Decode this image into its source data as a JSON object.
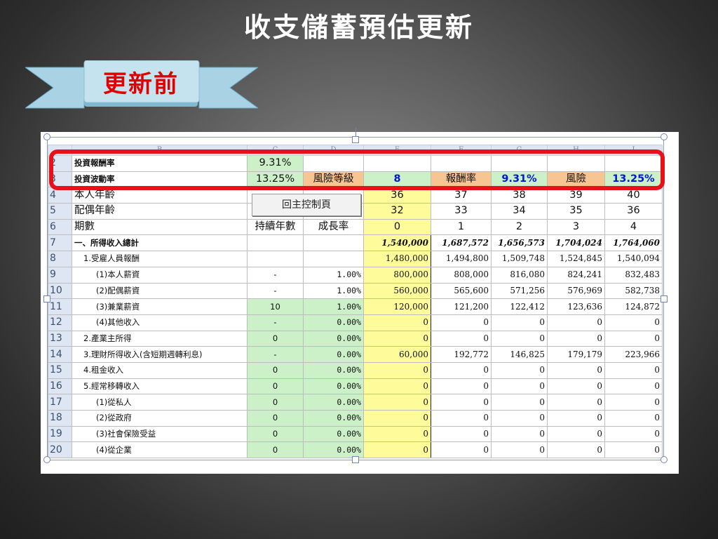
{
  "slide": {
    "title": "收支儲蓄預估更新",
    "ribbon_label": "更新前",
    "ribbon_color": "#a9d3e4",
    "label_color": "#e00000"
  },
  "spreadsheet": {
    "column_headers": [
      "B",
      "C",
      "D",
      "E",
      "F",
      "G",
      "H",
      "I"
    ],
    "control_button_label": "回主控制頁",
    "rows": [
      {
        "n": "2",
        "b": "投資報酬率",
        "c": "9.31%",
        "d": "",
        "e": "",
        "f": "",
        "g": "",
        "h": "",
        "i": ""
      },
      {
        "n": "3",
        "b": "投資波動率",
        "c": "13.25%",
        "d": "風險等級",
        "e": "8",
        "f": "報酬率",
        "g": "9.31%",
        "h": "風險",
        "i": "13.25%"
      },
      {
        "n": "4",
        "b": "本人年齡",
        "c": "",
        "d": "",
        "e": "36",
        "f": "37",
        "g": "38",
        "h": "39",
        "i": "40"
      },
      {
        "n": "5",
        "b": "配偶年齡",
        "c": "",
        "d": "",
        "e": "32",
        "f": "33",
        "g": "34",
        "h": "35",
        "i": "36"
      },
      {
        "n": "6",
        "b": "期數",
        "c": "持續年數",
        "d": "成長率",
        "e": "0",
        "f": "1",
        "g": "2",
        "h": "3",
        "i": "4"
      },
      {
        "n": "7",
        "b": "一、所得收入總計",
        "c": "",
        "d": "",
        "e": "1,540,000",
        "f": "1,687,572",
        "g": "1,656,573",
        "h": "1,704,024",
        "i": "1,764,060"
      },
      {
        "n": "8",
        "b": "1.受雇人員報酬",
        "c": "",
        "d": "",
        "e": "1,480,000",
        "f": "1,494,800",
        "g": "1,509,748",
        "h": "1,524,845",
        "i": "1,540,094"
      },
      {
        "n": "9",
        "b": "(1)本人薪資",
        "c": "-",
        "d": "1.00%",
        "e": "800,000",
        "f": "808,000",
        "g": "816,080",
        "h": "824,241",
        "i": "832,483"
      },
      {
        "n": "10",
        "b": "(2)配偶薪資",
        "c": "-",
        "d": "1.00%",
        "e": "560,000",
        "f": "565,600",
        "g": "571,256",
        "h": "576,969",
        "i": "582,738"
      },
      {
        "n": "11",
        "b": "(3)兼業薪資",
        "c": "10",
        "d": "1.00%",
        "e": "120,000",
        "f": "121,200",
        "g": "122,412",
        "h": "123,636",
        "i": "124,872"
      },
      {
        "n": "12",
        "b": "(4)其他收入",
        "c": "-",
        "d": "0.00%",
        "e": "0",
        "f": "0",
        "g": "0",
        "h": "0",
        "i": "0"
      },
      {
        "n": "13",
        "b": "2.產業主所得",
        "c": "0",
        "d": "0.00%",
        "e": "0",
        "f": "0",
        "g": "0",
        "h": "0",
        "i": "0"
      },
      {
        "n": "14",
        "b": "3.理財所得收入(含短期週轉利息)",
        "c": "-",
        "d": "0.00%",
        "e": "60,000",
        "f": "192,772",
        "g": "146,825",
        "h": "179,179",
        "i": "223,966"
      },
      {
        "n": "15",
        "b": "4.租金收入",
        "c": "0",
        "d": "0.00%",
        "e": "0",
        "f": "0",
        "g": "0",
        "h": "0",
        "i": "0"
      },
      {
        "n": "16",
        "b": "5.經常移轉收入",
        "c": "0",
        "d": "0.00%",
        "e": "0",
        "f": "0",
        "g": "0",
        "h": "0",
        "i": "0"
      },
      {
        "n": "17",
        "b": "(1)從私人",
        "c": "0",
        "d": "0.00%",
        "e": "0",
        "f": "0",
        "g": "0",
        "h": "0",
        "i": "0"
      },
      {
        "n": "18",
        "b": "(2)從政府",
        "c": "0",
        "d": "0.00%",
        "e": "0",
        "f": "0",
        "g": "0",
        "h": "0",
        "i": "0"
      },
      {
        "n": "19",
        "b": "(3)社會保險受益",
        "c": "0",
        "d": "0.00%",
        "e": "0",
        "f": "0",
        "g": "0",
        "h": "0",
        "i": "0"
      },
      {
        "n": "20",
        "b": "(4)從企業",
        "c": "0",
        "d": "0.00%",
        "e": "0",
        "f": "0",
        "g": "0",
        "h": "0",
        "i": "0"
      }
    ]
  },
  "colors": {
    "highlight_box": "#e8111a",
    "green_cells": "#ccf0c8",
    "yellow_cells": "#fefb9a",
    "orange_cells": "#f7c592",
    "blue_text": "#0017d6"
  }
}
